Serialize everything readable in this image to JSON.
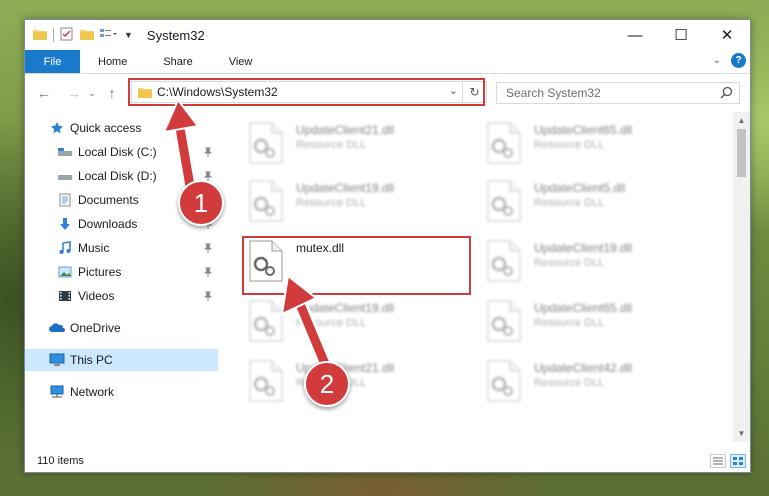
{
  "window": {
    "title": "System32",
    "controls": {
      "minimize": "—",
      "maximize": "☐",
      "close": "✕"
    }
  },
  "ribbon": {
    "tabs": [
      "File",
      "Home",
      "Share",
      "View"
    ],
    "help": "?"
  },
  "navigation": {
    "address": "C:\\Windows\\System32",
    "search_placeholder": "Search System32"
  },
  "sidebar": {
    "items": [
      {
        "label": "Quick access",
        "icon": "star-icon"
      },
      {
        "label": "Local Disk (C:)",
        "icon": "drive-icon",
        "pinned": true
      },
      {
        "label": "Local Disk (D:)",
        "icon": "drive-icon",
        "pinned": true
      },
      {
        "label": "Documents",
        "icon": "documents-icon",
        "pinned": true
      },
      {
        "label": "Downloads",
        "icon": "downloads-icon",
        "pinned": true
      },
      {
        "label": "Music",
        "icon": "music-icon",
        "pinned": true
      },
      {
        "label": "Pictures",
        "icon": "pictures-icon",
        "pinned": true
      },
      {
        "label": "Videos",
        "icon": "videos-icon",
        "pinned": true
      },
      {
        "label": "OneDrive",
        "icon": "onedrive-icon"
      },
      {
        "label": "This PC",
        "icon": "pc-icon",
        "selected": true
      },
      {
        "label": "Network",
        "icon": "network-icon"
      }
    ]
  },
  "files": [
    {
      "name": "UpdateClient21.dll",
      "type": "Resource DLL"
    },
    {
      "name": "UpdateClient65.dll",
      "type": "Resource DLL"
    },
    {
      "name": "UpdateClient19.dll",
      "type": "Resource DLL"
    },
    {
      "name": "UpdateClient5.dll",
      "type": "Resource DLL"
    },
    {
      "name": "mutex.dll",
      "type": ""
    },
    {
      "name": "UpdateClient19.dll",
      "type": "Resource DLL"
    },
    {
      "name": "UpdateClient19.dll",
      "type": "Resource DLL"
    },
    {
      "name": "UpdateClient65.dll",
      "type": "Resource DLL"
    },
    {
      "name": "UpdateClient21.dll",
      "type": "Resource DLL"
    },
    {
      "name": "UpdateClient42.dll",
      "type": "Resource DLL"
    }
  ],
  "status": {
    "item_count": "110 items"
  },
  "annotations": {
    "step1": "1",
    "step2": "2"
  },
  "colors": {
    "accent": "#1979ca",
    "highlight": "#d23b3b",
    "selected": "#cce8ff"
  }
}
